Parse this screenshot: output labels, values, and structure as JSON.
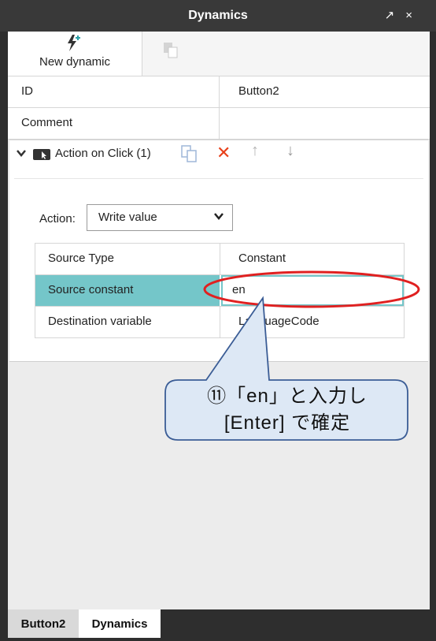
{
  "window": {
    "title": "Dynamics",
    "controls": [
      "↗",
      "×"
    ]
  },
  "toolbar": {
    "new_dynamic_label": "New dynamic"
  },
  "properties": [
    {
      "key": "ID",
      "value": "Button2"
    },
    {
      "key": "Comment",
      "value": ""
    }
  ],
  "action_section": {
    "header_label": "Action on Click (1)",
    "action_label": "Action:",
    "action_value": "Write value",
    "rows": [
      {
        "key": "Source Type",
        "value": "Constant"
      },
      {
        "key": "Source constant",
        "value": "en"
      },
      {
        "key": "Destination variable",
        "value": "LanguageCode"
      }
    ]
  },
  "callout": {
    "line1": "⑪「en」と入力し",
    "line2": "[Enter] で確定"
  },
  "bottom_tabs": [
    "Button2",
    "Dynamics"
  ],
  "colors": {
    "selected_row": "#74c6c9",
    "delete_icon": "#e8401a",
    "highlight_ellipse": "#e02020",
    "callout_fill": "#dde8f5",
    "callout_border": "#3b5d96"
  }
}
